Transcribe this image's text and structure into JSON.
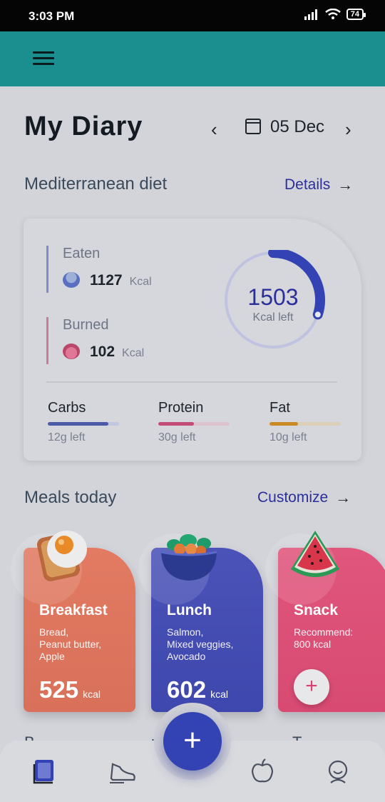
{
  "status_bar": {
    "time": "3:03 PM",
    "battery": "74"
  },
  "header": {
    "title": "My Diary",
    "date": "05 Dec"
  },
  "diet_section": {
    "title": "Mediterranean diet",
    "link": "Details"
  },
  "summary": {
    "eaten": {
      "label": "Eaten",
      "value": "1127",
      "unit": "Kcal"
    },
    "burned": {
      "label": "Burned",
      "value": "102",
      "unit": "Kcal"
    },
    "ring": {
      "value": "1503",
      "label": "Kcal left",
      "progress_fraction": 0.3
    },
    "macros": [
      {
        "name": "Carbs",
        "left": "12g left",
        "fill_fraction": 0.85,
        "color": "#4a5aa6",
        "track": "#c0c7de"
      },
      {
        "name": "Protein",
        "left": "30g left",
        "fill_fraction": 0.5,
        "color": "#c14d75",
        "track": "#dcc2cc"
      },
      {
        "name": "Fat",
        "left": "10g left",
        "fill_fraction": 0.4,
        "color": "#c98a24",
        "track": "#dccfb8"
      }
    ]
  },
  "meals_section": {
    "title": "Meals today",
    "link": "Customize"
  },
  "meals": [
    {
      "name": "Breakfast",
      "desc": "Bread,\nPeanut butter,\nApple",
      "kcal": "525",
      "unit": "kcal",
      "icon": "fried-egg-toast-icon",
      "color_top": "#e27b62",
      "color_bottom": "#d9705a"
    },
    {
      "name": "Lunch",
      "desc": "Salmon,\nMixed veggies,\nAvocado",
      "kcal": "602",
      "unit": "kcal",
      "icon": "salad-bowl-icon",
      "color_top": "#4b53b8",
      "color_bottom": "#3e47ad"
    },
    {
      "name": "Snack",
      "desc": "Recommend:\n800 kcal",
      "add": "+",
      "icon": "watermelon-icon",
      "color_top": "#e0567c",
      "color_bottom": "#d84a72"
    }
  ],
  "peek": {
    "left": "B",
    "middle": "ne",
    "right": "T"
  },
  "nav": {
    "fab": "+",
    "items": [
      "book-icon",
      "shoe-icon",
      "apple-icon",
      "profile-icon"
    ]
  },
  "colors": {
    "accent": "#2a2f9a",
    "appbar": "#1b8e90"
  }
}
